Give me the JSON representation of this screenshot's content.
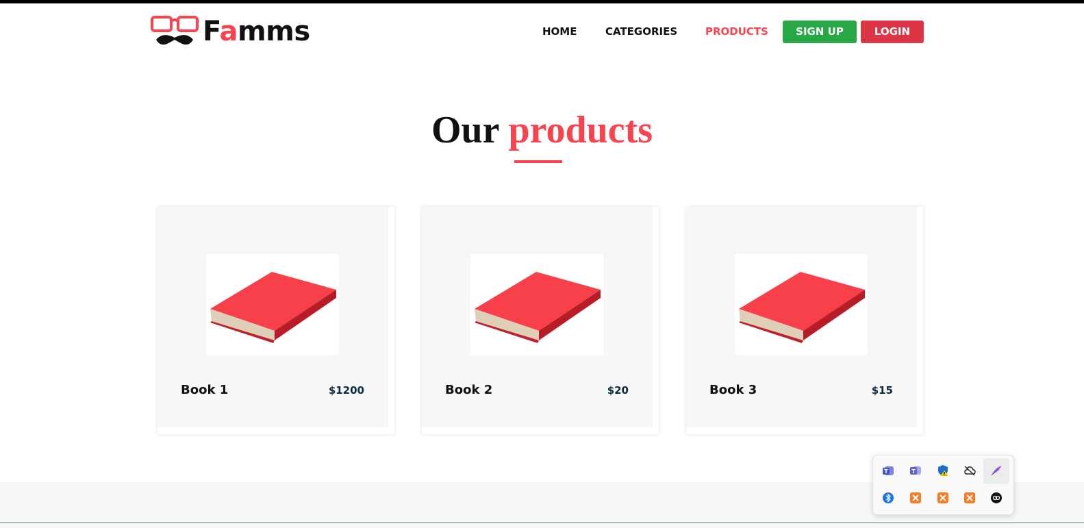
{
  "brand": {
    "name_prefix": "F",
    "name_accent": "a",
    "name_suffix": "mms"
  },
  "nav": {
    "home": "HOME",
    "categories": "CATEGORIES",
    "products": "PRODUCTS",
    "active": "products"
  },
  "auth": {
    "signup": "SIGN UP",
    "login": "LOGIN"
  },
  "section": {
    "title_plain": "Our",
    "title_accent": "products"
  },
  "products": [
    {
      "name": "Book 1",
      "price": "$1200",
      "image": "red-book"
    },
    {
      "name": "Book 2",
      "price": "$20",
      "image": "red-book"
    },
    {
      "name": "Book 3",
      "price": "$15",
      "image": "red-book"
    }
  ],
  "colors": {
    "accent": "#f7444e",
    "signup": "#28a745",
    "login": "#dc3545",
    "card_bg": "#f5f7f9"
  },
  "tray": {
    "icons": [
      "teams-icon",
      "teams-classic-icon",
      "defender-warning-icon",
      "onedrive-offline-icon",
      "feather-icon",
      "bluetooth-icon",
      "xampp-icon",
      "xampp-icon",
      "xampp-icon",
      "app-circle-icon"
    ]
  }
}
